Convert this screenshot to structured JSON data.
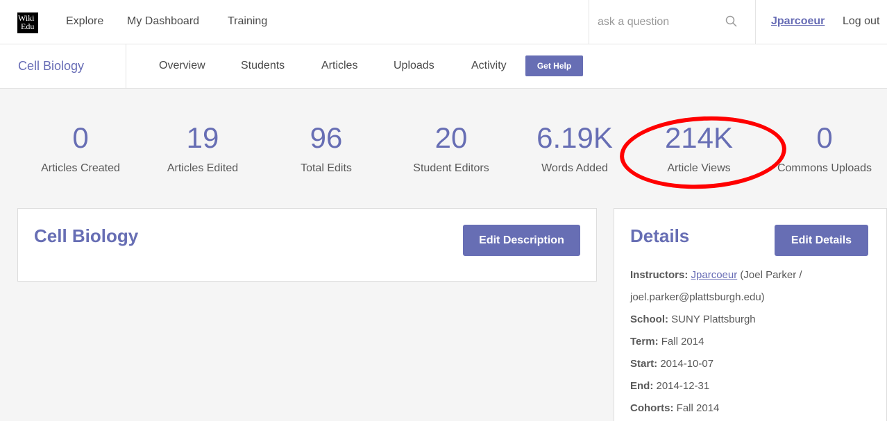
{
  "topnav": {
    "logo_line1": "Wiki",
    "logo_line2": "Edu",
    "links": [
      "Explore",
      "My Dashboard",
      "Training"
    ],
    "search_placeholder": "ask a question",
    "user": "Jparcoeur",
    "logout": "Log out"
  },
  "coursenav": {
    "title": "Cell Biology",
    "tabs": [
      "Overview",
      "Students",
      "Articles",
      "Uploads",
      "Activity"
    ],
    "help_button": "Get Help"
  },
  "stats": [
    {
      "value": "0",
      "label": "Articles Created"
    },
    {
      "value": "19",
      "label": "Articles Edited"
    },
    {
      "value": "96",
      "label": "Total Edits"
    },
    {
      "value": "20",
      "label": "Student Editors"
    },
    {
      "value": "6.19K",
      "label": "Words Added"
    },
    {
      "value": "214K",
      "label": "Article Views"
    },
    {
      "value": "0",
      "label": "Commons Uploads"
    }
  ],
  "description_panel": {
    "title": "Cell Biology",
    "button": "Edit Description"
  },
  "details_panel": {
    "title": "Details",
    "button": "Edit Details",
    "instructors_label": "Instructors:",
    "instructor_link": "Jparcoeur",
    "instructor_rest": "(Joel Parker /",
    "instructor_email": "joel.parker@plattsburgh.edu)",
    "school_label": "School:",
    "school": "SUNY Plattsburgh",
    "term_label": "Term:",
    "term": "Fall 2014",
    "start_label": "Start:",
    "start": "2014-10-07",
    "end_label": "End:",
    "end": "2014-12-31",
    "cohorts_label": "Cohorts:",
    "cohorts": "Fall 2014"
  },
  "colors": {
    "accent": "#676eb4",
    "annotation": "#ff0000"
  }
}
